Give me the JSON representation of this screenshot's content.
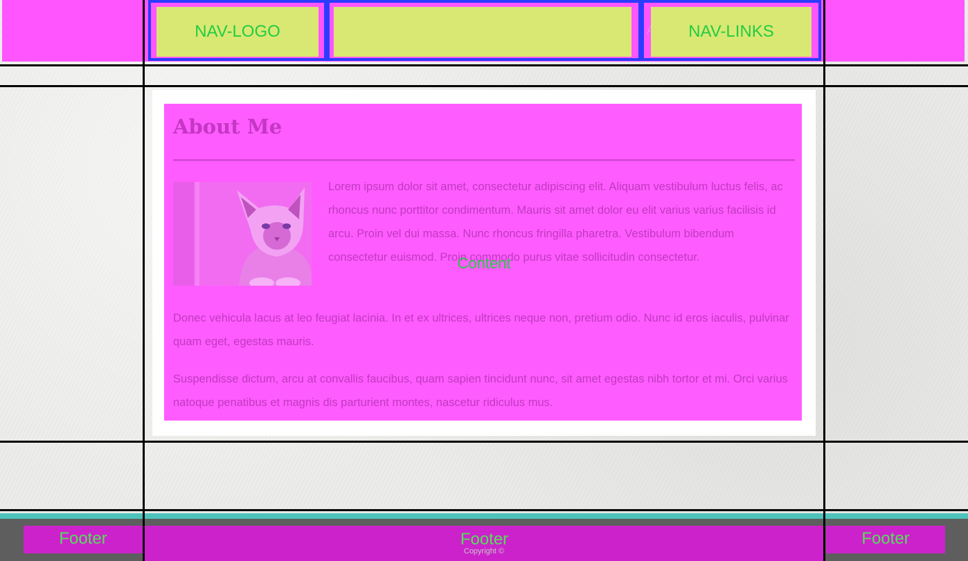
{
  "header": {
    "logo_label": "NAV-LOGO",
    "links_label": "NAV-LINKS",
    "links_underlay": "A"
  },
  "content": {
    "heading": "About Me",
    "overlay_label": "Content",
    "image_alt": "cat photo",
    "paragraphs": [
      "Lorem ipsum dolor sit amet, consectetur adipiscing elit. Aliquam vestibulum luctus felis, ac rhoncus nunc porttitor condimentum. Mauris sit amet dolor eu elit varius varius facilisis id arcu. Proin vel dui massa. Nunc rhoncus fringilla pharetra. Vestibulum bibendum consectetur euismod. Proin commodo purus vitae sollicitudin consectetur.",
      "Donec vehicula lacus at leo feugiat lacinia. In et ex ultrices, ultrices neque non, pretium odio. Nunc id eros iaculis, pulvinar quam eget, egestas mauris.",
      "Suspendisse dictum, arcu at convallis faucibus, quam sapien tincidunt nunc, sit amet egestas nibh tortor et mi. Orci varius natoque penatibus et magnis dis parturient montes, nascetur ridiculus mus."
    ]
  },
  "footer": {
    "left_label": "Footer",
    "center_label": "Footer",
    "right_label": "Footer",
    "copyright": "Copyright ©"
  },
  "colors": {
    "header_overlay": "#ff55ff",
    "nav_box_fill": "#d9e872",
    "nav_box_border": "#2b3cff",
    "label_green": "#22cc44",
    "content_overlay": "#ff5cff",
    "footer_overlay": "#cc22cc",
    "footer_accent": "#4ec3bb"
  }
}
